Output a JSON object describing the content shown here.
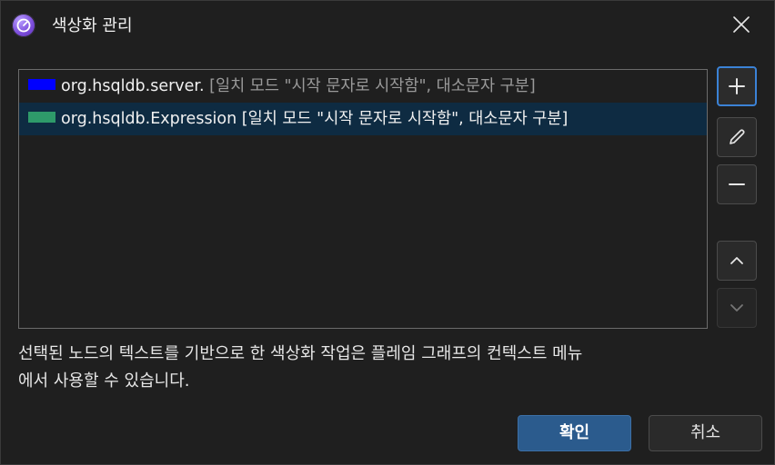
{
  "window": {
    "title": "색상화 관리",
    "app_icon": "app-logo-icon",
    "close_icon": "close-icon"
  },
  "rules": [
    {
      "color": "#0000ff",
      "pattern": "org.hsqldb.server.",
      "options": "[일치 모드 \"시작 문자로 시작함\", 대소문자 구분]",
      "selected": false
    },
    {
      "color": "#2e9a6a",
      "pattern": "org.hsqldb.Expression",
      "options": "[일치 모드 \"시작 문자로 시작함\", 대소문자 구분]",
      "selected": true
    }
  ],
  "side_buttons": {
    "add_icon": "plus-icon",
    "edit_icon": "pencil-icon",
    "remove_icon": "minus-icon",
    "move_up_icon": "chevron-up-icon",
    "move_down_icon": "chevron-down-icon"
  },
  "info_text_line1": "선택된 노드의 텍스트를 기반으로 한 색상화 작업은 플레임 그래프의 컨텍스트 메뉴",
  "info_text_line2": "에서 사용할 수 있습니다.",
  "buttons": {
    "ok": "확인",
    "cancel": "취소"
  },
  "colors": {
    "accent": "#3b82d6",
    "primary_button": "#2b5b8d",
    "selection": "#0e2b42"
  }
}
